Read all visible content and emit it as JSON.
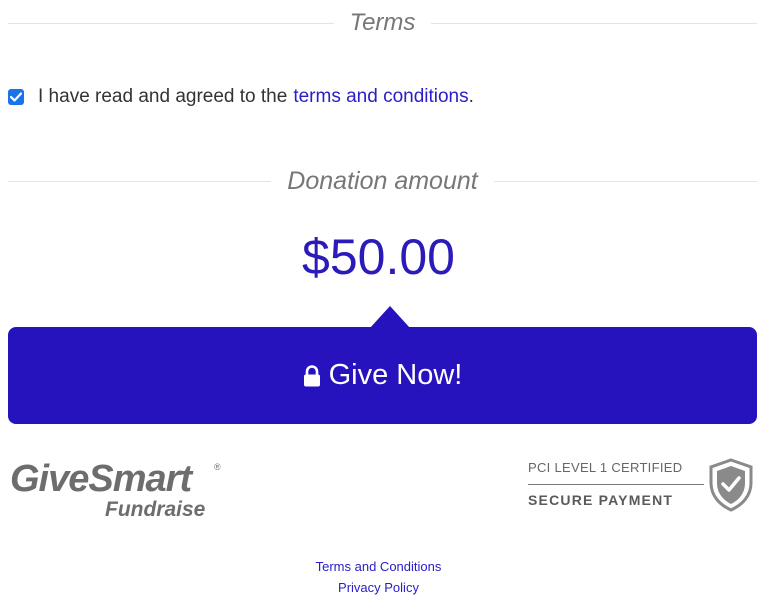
{
  "terms_section": {
    "legend": "Terms",
    "agree_text": "I have read and agreed to the",
    "terms_link": "terms and conditions",
    "period": ".",
    "checked": true
  },
  "donation_section": {
    "legend": "Donation amount",
    "amount": "$50.00"
  },
  "give_button": {
    "icon": "lock-icon",
    "label": "Give Now!"
  },
  "branding": {
    "logo_main": "GiveSmart",
    "logo_sub": "Fundraise",
    "logo_reg": "®",
    "pci_line1": "PCI LEVEL 1 CERTIFIED",
    "pci_line2": "SECURE PAYMENT",
    "pci_icon": "shield-check-icon"
  },
  "footer": {
    "terms_link": "Terms and Conditions",
    "privacy_link": "Privacy Policy"
  },
  "colors": {
    "accent": "#2613be",
    "link": "#2b20c7",
    "checkbox": "#1a73e8"
  }
}
